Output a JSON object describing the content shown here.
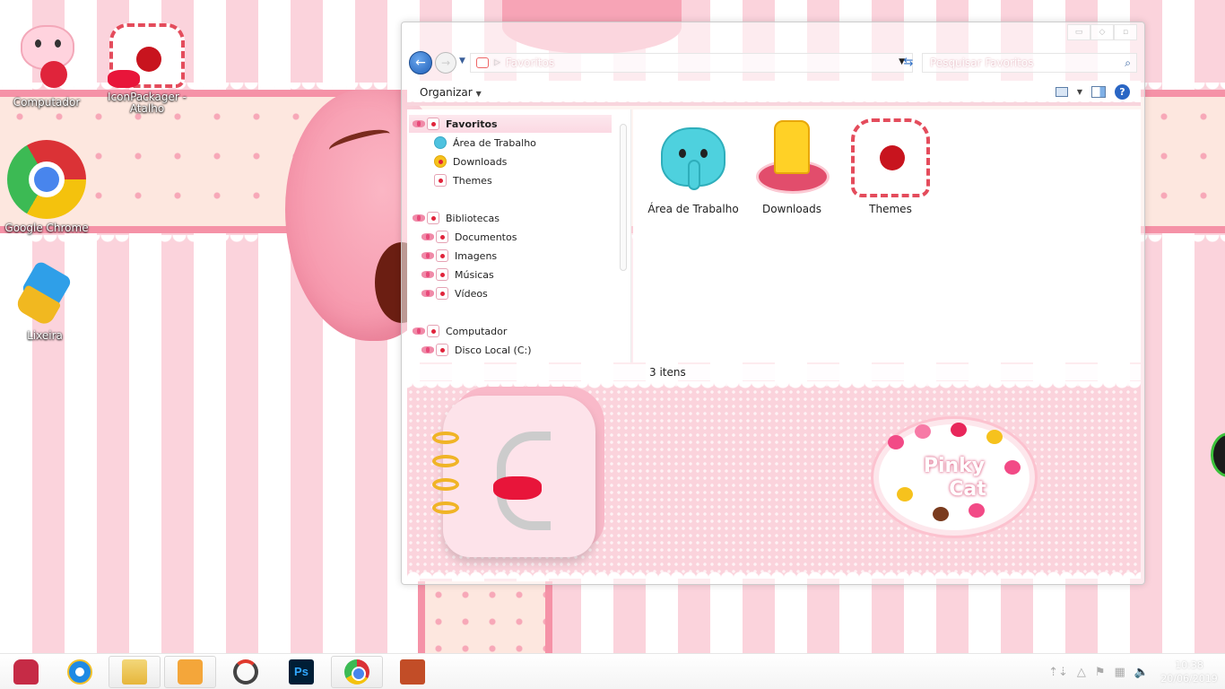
{
  "desktop": {
    "icons": [
      {
        "label": "Computador",
        "icon": "pink-cat-icon"
      },
      {
        "label": "IconPackager - Atalho",
        "icon": "envelope-icon"
      },
      {
        "label": "Google Chrome",
        "icon": "chrome-icon"
      },
      {
        "label": "Lixeira",
        "icon": "recycle-bin-icon"
      }
    ]
  },
  "explorer": {
    "controls": {
      "minimize": "▭",
      "maximize": "◇",
      "close": "▫"
    },
    "address": {
      "crumb": "Favoritos"
    },
    "search": {
      "placeholder": "Pesquisar Favoritos"
    },
    "toolbar": {
      "organize": "Organizar"
    },
    "nav": {
      "favorites_header": "Favoritos",
      "favorites": [
        "Área de Trabalho",
        "Downloads",
        "Themes"
      ],
      "libraries_header": "Bibliotecas",
      "libraries": [
        "Documentos",
        "Imagens",
        "Músicas",
        "Vídeos"
      ],
      "computer_header": "Computador",
      "drives": [
        "Disco Local (C:)"
      ]
    },
    "items": [
      {
        "label": "Área de Trabalho",
        "icon": "elephant-icon"
      },
      {
        "label": "Downloads",
        "icon": "download-arrow-icon"
      },
      {
        "label": "Themes",
        "icon": "envelope-icon"
      }
    ],
    "status": {
      "count": "3 itens"
    },
    "details_badge": {
      "line1": "Pinky",
      "line2": "Cat"
    }
  },
  "taskbar": {
    "items": [
      "start",
      "internet-explorer",
      "file-explorer",
      "media-player",
      "sync-app",
      "photoshop",
      "chrome",
      "book-app"
    ],
    "ps_label": "Ps",
    "clock": {
      "time": "10:38",
      "date": "20/06/2019"
    }
  },
  "colors": {
    "accent_pink": "#f592a7",
    "light_pink": "#fbd3dc",
    "taskbar": "#ffffff"
  }
}
